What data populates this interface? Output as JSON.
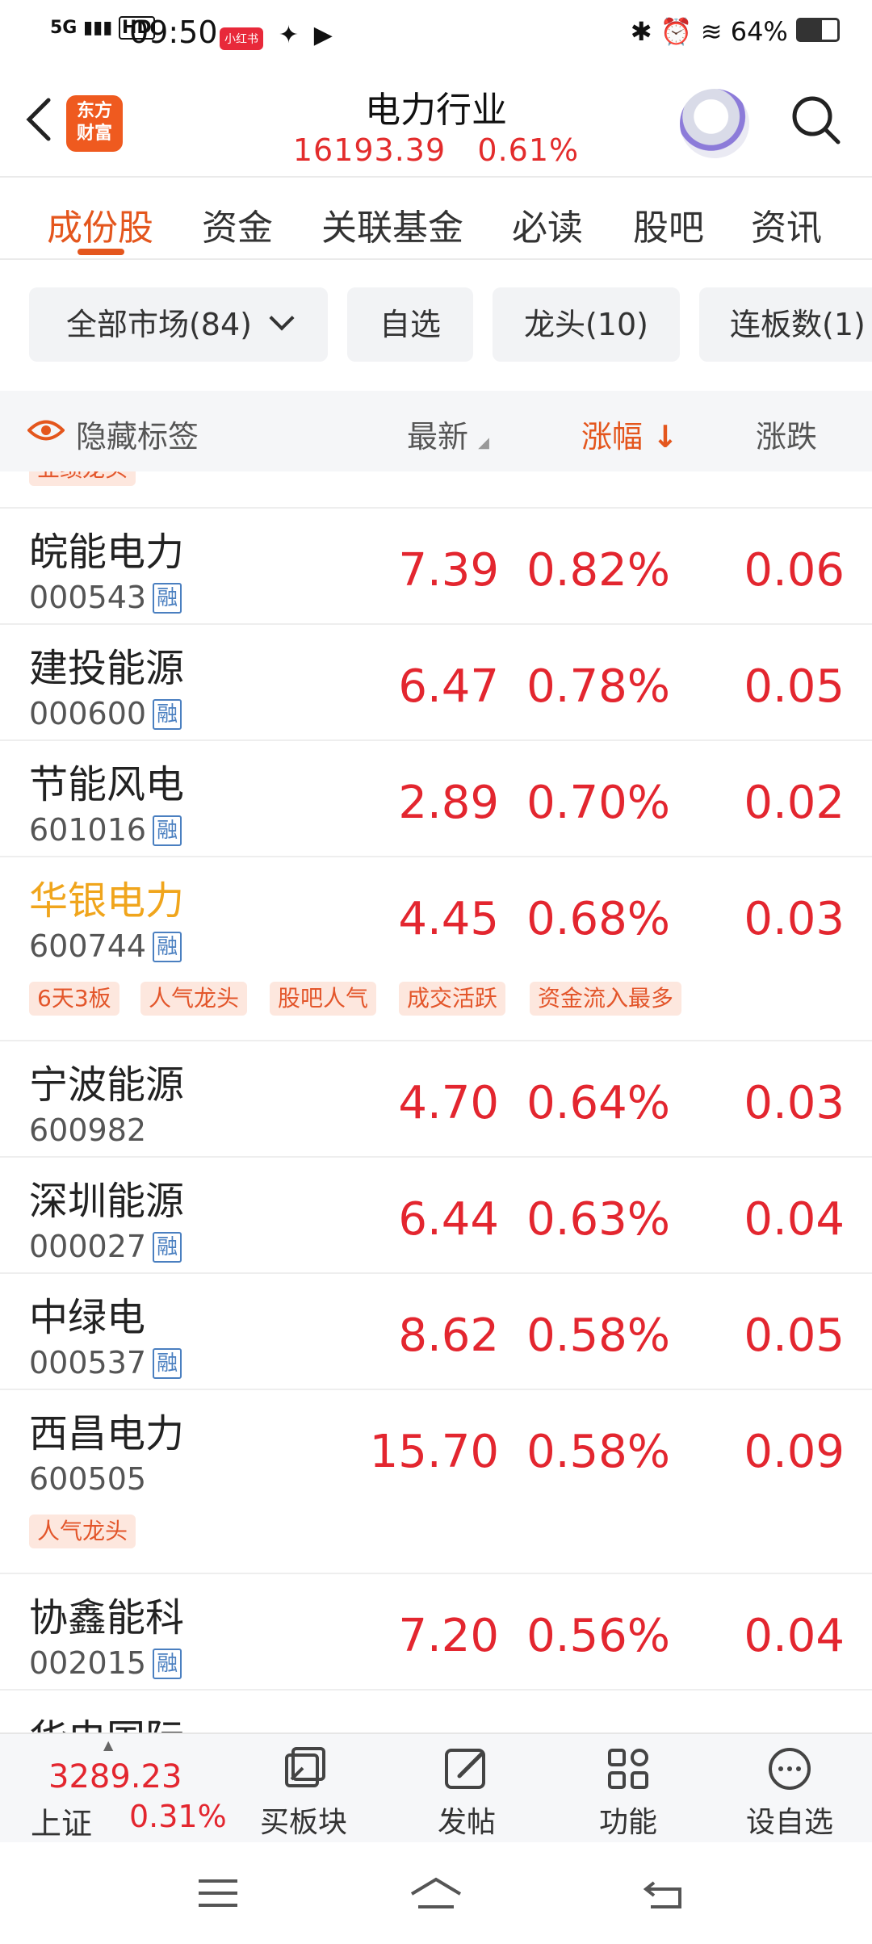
{
  "status": {
    "left_text": "5G",
    "hd": "HD",
    "time": "09:50",
    "battery": "64%"
  },
  "header": {
    "title": "电力行业",
    "price": "16193.39",
    "change": "0.61%",
    "logo_line1": "东方",
    "logo_line2": "财富"
  },
  "tabs": [
    "成份股",
    "资金",
    "关联基金",
    "必读",
    "股吧",
    "资讯"
  ],
  "chips": [
    "全部市场(84)",
    "自选",
    "龙头(10)",
    "连板数(1)"
  ],
  "columns": {
    "hide": "隐藏标签",
    "latest": "最新",
    "change": "涨幅",
    "diff": "涨跌"
  },
  "partial_tag": "业绩龙头",
  "rows": [
    {
      "name": "皖能电力",
      "code": "000543",
      "rong": "融",
      "price": "7.39",
      "pct": "0.82%",
      "diff": "0.06"
    },
    {
      "name": "建投能源",
      "code": "000600",
      "rong": "融",
      "price": "6.47",
      "pct": "0.78%",
      "diff": "0.05"
    },
    {
      "name": "节能风电",
      "code": "601016",
      "rong": "融",
      "price": "2.89",
      "pct": "0.70%",
      "diff": "0.02"
    },
    {
      "name": "华银电力",
      "code": "600744",
      "rong": "融",
      "price": "4.45",
      "pct": "0.68%",
      "diff": "0.03",
      "tags": [
        "6天3板",
        "人气龙头",
        "股吧人气",
        "成交活跃",
        "资金流入最多"
      ]
    },
    {
      "name": "宁波能源",
      "code": "600982",
      "rong": "",
      "price": "4.70",
      "pct": "0.64%",
      "diff": "0.03"
    },
    {
      "name": "深圳能源",
      "code": "000027",
      "rong": "融",
      "price": "6.44",
      "pct": "0.63%",
      "diff": "0.04"
    },
    {
      "name": "中绿电",
      "code": "000537",
      "rong": "融",
      "price": "8.62",
      "pct": "0.58%",
      "diff": "0.05"
    },
    {
      "name": "西昌电力",
      "code": "600505",
      "rong": "",
      "price": "15.70",
      "pct": "0.58%",
      "diff": "0.09",
      "tags": [
        "人气龙头"
      ]
    },
    {
      "name": "协鑫能科",
      "code": "002015",
      "rong": "融",
      "price": "7.20",
      "pct": "0.56%",
      "diff": "0.04"
    },
    {
      "name": "华电国际"
    }
  ],
  "bottom": {
    "index_value": "3289.23",
    "index_name": "上证",
    "index_change": "0.31%",
    "items": [
      "买板块",
      "发帖",
      "功能",
      "设自选"
    ]
  }
}
